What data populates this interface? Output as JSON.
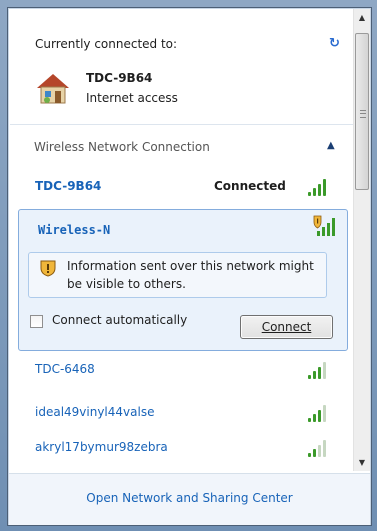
{
  "current": {
    "label": "Currently connected to:",
    "network_name": "TDC-9B64",
    "access": "Internet access"
  },
  "section": {
    "label": "Wireless Network Connection"
  },
  "connected_network": {
    "name": "TDC-9B64",
    "status": "Connected"
  },
  "selected_network": {
    "name": "Wireless-N",
    "warning": "Information sent over this network might be visible to others.",
    "auto_label": "Connect automatically",
    "auto_checked": false,
    "connect_label": "Connect"
  },
  "networks": [
    {
      "name": "TDC-6468"
    },
    {
      "name": "ideal49vinyl44valse"
    },
    {
      "name": "akryl17bymur98zebra"
    }
  ],
  "footer": {
    "link": "Open Network and Sharing Center"
  },
  "colors": {
    "link": "#1863b8",
    "signal_green": "#3b9a2a",
    "selection_bg": "#eaf2fb"
  },
  "icons": {
    "refresh": "refresh-icon",
    "house": "house-icon",
    "collapse": "chevron-up-icon",
    "signal": "signal-strength-icon",
    "shield": "security-shield-icon"
  }
}
